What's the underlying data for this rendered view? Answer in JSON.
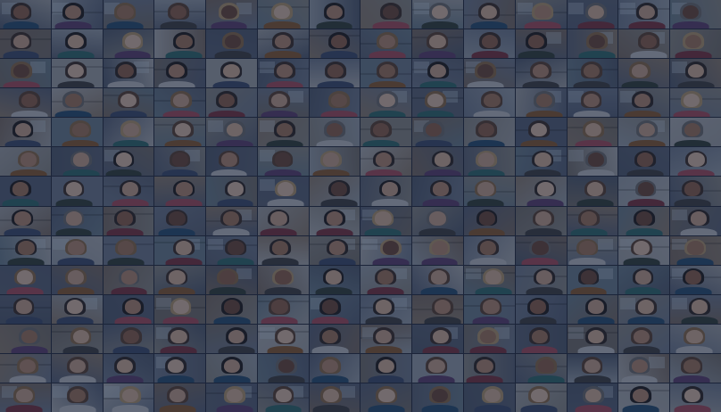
{
  "meeting": {
    "view_mode": "gallery",
    "rows": 14,
    "columns": 14,
    "participant_tiles_visible": 196
  },
  "palette": {
    "overlay_tint": "#18223a",
    "backgrounds": [
      "#6f7b8f",
      "#8a8a86",
      "#5b6476",
      "#9aa3ad",
      "#7a6d63",
      "#4f5a6d",
      "#a3a6a9",
      "#6a7f8e",
      "#8d7f70",
      "#566177",
      "#b0b3b6",
      "#74706b"
    ],
    "skins": [
      "#c9a48c",
      "#b58a70",
      "#8e6148",
      "#d7b39a",
      "#a27559",
      "#6b4633",
      "#e0c2ab"
    ],
    "hairs": [
      "#2b221d",
      "#5a3f2d",
      "#8c6a45",
      "#1b1716",
      "#b79a6d",
      "#6e6e6e",
      "#3a2a22"
    ],
    "clothes": [
      "#3b4a6b",
      "#7a2f3b",
      "#2f3c34",
      "#c0c4c8",
      "#5c3d6e",
      "#244d70",
      "#8a5a2b",
      "#3c3c3c",
      "#a84b5a",
      "#2d6a6a"
    ]
  }
}
